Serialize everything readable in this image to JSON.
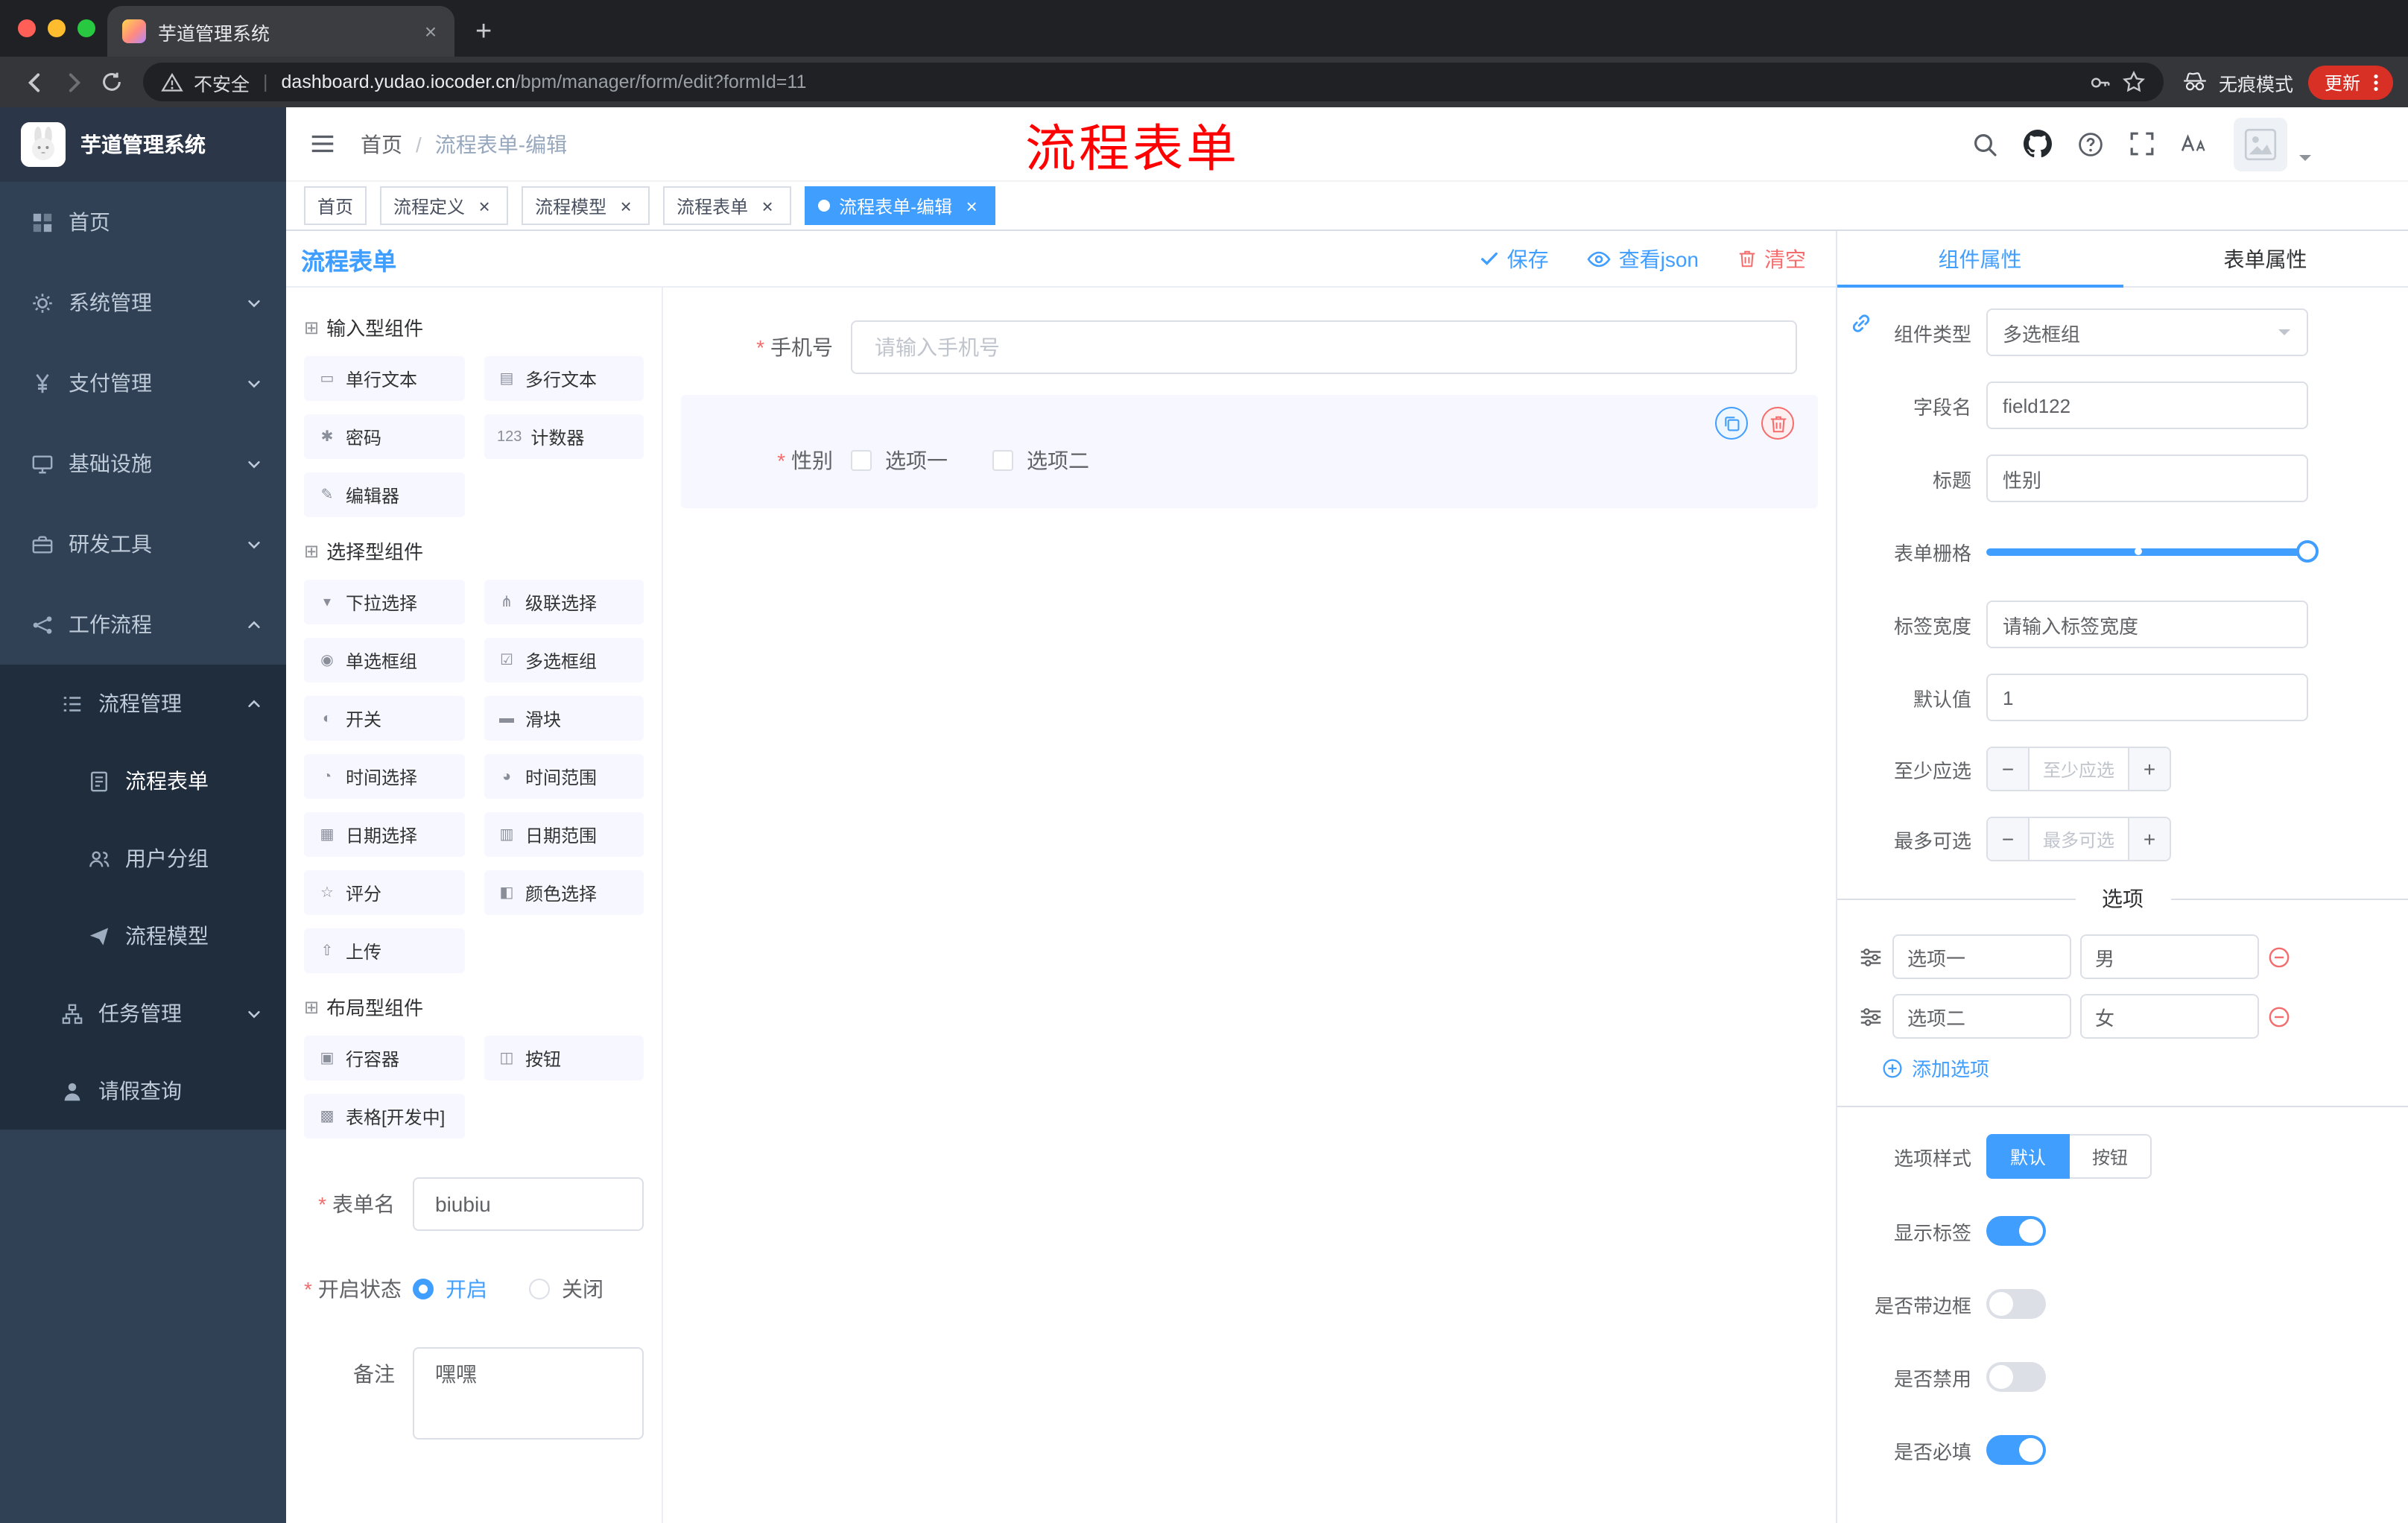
{
  "browser": {
    "tab_title": "芋道管理系统",
    "security_label": "不安全",
    "url_host": "dashboard.yudao.iocoder.cn",
    "url_path": "/bpm/manager/form/edit?formId=11",
    "incognito_label": "无痕模式",
    "update_label": "更新"
  },
  "sidebar": {
    "logo_title": "芋道管理系统",
    "items": [
      {
        "name": "home",
        "label": "首页",
        "icon": "dashboard-icon",
        "level": 1
      },
      {
        "name": "system-mgmt",
        "label": "系统管理",
        "icon": "gear-icon",
        "level": 1,
        "chevron": "down"
      },
      {
        "name": "payment-mgmt",
        "label": "支付管理",
        "icon": "yen-icon",
        "level": 1,
        "chevron": "down"
      },
      {
        "name": "infrastructure",
        "label": "基础设施",
        "icon": "monitor-icon",
        "level": 1,
        "chevron": "down"
      },
      {
        "name": "dev-tools",
        "label": "研发工具",
        "icon": "toolbox-icon",
        "level": 1,
        "chevron": "down"
      },
      {
        "name": "workflow",
        "label": "工作流程",
        "icon": "workflow-icon",
        "level": 1,
        "chevron": "up"
      },
      {
        "name": "process-mgmt",
        "label": "流程管理",
        "icon": "list-icon",
        "level": 2,
        "chevron": "up",
        "dark": true
      },
      {
        "name": "process-form",
        "label": "流程表单",
        "icon": "document-icon",
        "level": 3,
        "dark": true,
        "active": true
      },
      {
        "name": "user-group",
        "label": "用户分组",
        "icon": "users-icon",
        "level": 3,
        "dark": true
      },
      {
        "name": "process-model",
        "label": "流程模型",
        "icon": "send-icon",
        "level": 3,
        "dark": true
      },
      {
        "name": "task-mgmt",
        "label": "任务管理",
        "icon": "org-icon",
        "level": 2,
        "chevron": "down",
        "dark": true
      },
      {
        "name": "leave-query",
        "label": "请假查询",
        "icon": "person-icon",
        "level": 2,
        "dark": true
      }
    ]
  },
  "header": {
    "breadcrumb": [
      "首页",
      "流程表单-编辑"
    ],
    "red_title": "流程表单"
  },
  "tags": [
    {
      "label": "首页",
      "closable": false,
      "active": false
    },
    {
      "label": "流程定义",
      "closable": true,
      "active": false
    },
    {
      "label": "流程模型",
      "closable": true,
      "active": false
    },
    {
      "label": "流程表单",
      "closable": true,
      "active": false
    },
    {
      "label": "流程表单-编辑",
      "closable": true,
      "active": true
    }
  ],
  "designer": {
    "panel_title": "流程表单",
    "actions": {
      "save": "保存",
      "view_json": "查看json",
      "clear": "清空"
    },
    "groups": [
      {
        "title": "输入型组件",
        "items": [
          {
            "name": "single-line-text",
            "label": "单行文本",
            "glyph": "▭"
          },
          {
            "name": "multi-line-text",
            "label": "多行文本",
            "glyph": "▤"
          },
          {
            "name": "password",
            "label": "密码",
            "glyph": "✱"
          },
          {
            "name": "counter",
            "label": "计数器",
            "glyph": "123"
          },
          {
            "name": "editor",
            "label": "编辑器",
            "glyph": "✎"
          }
        ]
      },
      {
        "title": "选择型组件",
        "items": [
          {
            "name": "select",
            "label": "下拉选择",
            "glyph": "▾"
          },
          {
            "name": "cascader",
            "label": "级联选择",
            "glyph": "⋔"
          },
          {
            "name": "radio-group",
            "label": "单选框组",
            "glyph": "◉"
          },
          {
            "name": "checkbox-group",
            "label": "多选框组",
            "glyph": "☑"
          },
          {
            "name": "switch",
            "label": "开关",
            "glyph": "◐"
          },
          {
            "name": "slider",
            "label": "滑块",
            "glyph": "▬"
          },
          {
            "name": "time-picker",
            "label": "时间选择",
            "glyph": "◔"
          },
          {
            "name": "time-range",
            "label": "时间范围",
            "glyph": "◕"
          },
          {
            "name": "date-picker",
            "label": "日期选择",
            "glyph": "▦"
          },
          {
            "name": "date-range",
            "label": "日期范围",
            "glyph": "▥"
          },
          {
            "name": "rate",
            "label": "评分",
            "glyph": "☆"
          },
          {
            "name": "color-picker",
            "label": "颜色选择",
            "glyph": "◧"
          },
          {
            "name": "upload",
            "label": "上传",
            "glyph": "⇧"
          }
        ]
      },
      {
        "title": "布局型组件",
        "items": [
          {
            "name": "row-container",
            "label": "行容器",
            "glyph": "▣"
          },
          {
            "name": "button",
            "label": "按钮",
            "glyph": "◫"
          },
          {
            "name": "table-dev",
            "label": "表格[开发中]",
            "glyph": "▩"
          }
        ]
      }
    ],
    "meta_form": {
      "name_label": "表单名",
      "name_value": "biubiu",
      "status_label": "开启状态",
      "status_options": [
        {
          "label": "开启",
          "checked": true
        },
        {
          "label": "关闭",
          "checked": false
        }
      ],
      "remark_label": "备注",
      "remark_value": "嘿嘿"
    },
    "canvas_fields": [
      {
        "label": "手机号",
        "required": true,
        "control": "input",
        "placeholder": "请输入手机号"
      },
      {
        "label": "性别",
        "required": true,
        "control": "checkbox-group",
        "options": [
          "选项一",
          "选项二"
        ],
        "selected": true
      }
    ]
  },
  "inspector": {
    "tabs": [
      {
        "label": "组件属性",
        "active": true
      },
      {
        "label": "表单属性",
        "active": false
      }
    ],
    "component_type_label": "组件类型",
    "component_type_value": "多选框组",
    "field_name_label": "字段名",
    "field_name_value": "field122",
    "title_label": "标题",
    "title_value": "性别",
    "grid_label": "表单栅格",
    "label_width_label": "标签宽度",
    "label_width_placeholder": "请输入标签宽度",
    "default_label": "默认值",
    "default_value": "1",
    "min_label": "至少应选",
    "min_placeholder": "至少应选",
    "max_label": "最多可选",
    "max_placeholder": "最多可选",
    "options_title": "选项",
    "options": [
      {
        "label": "选项一",
        "value": "男"
      },
      {
        "label": "选项二",
        "value": "女"
      }
    ],
    "add_option_label": "添加选项",
    "option_style_label": "选项样式",
    "option_style_choices": [
      {
        "label": "默认",
        "active": true
      },
      {
        "label": "按钮",
        "active": false
      }
    ],
    "switch_rows": [
      {
        "name": "show-label",
        "label": "显示标签",
        "on": true
      },
      {
        "name": "with-border",
        "label": "是否带边框",
        "on": false
      },
      {
        "name": "disabled",
        "label": "是否禁用",
        "on": false
      },
      {
        "name": "required",
        "label": "是否必填",
        "on": true
      }
    ]
  },
  "colors": {
    "accent": "#409EFF",
    "danger": "#F56C6C",
    "sidebar_bg": "#304156",
    "sidebar_sub_bg": "#1F2D3D",
    "red_title": "#FF0000",
    "update_pill": "#D93025",
    "selected_widget_bg": "#F6F7FF"
  }
}
